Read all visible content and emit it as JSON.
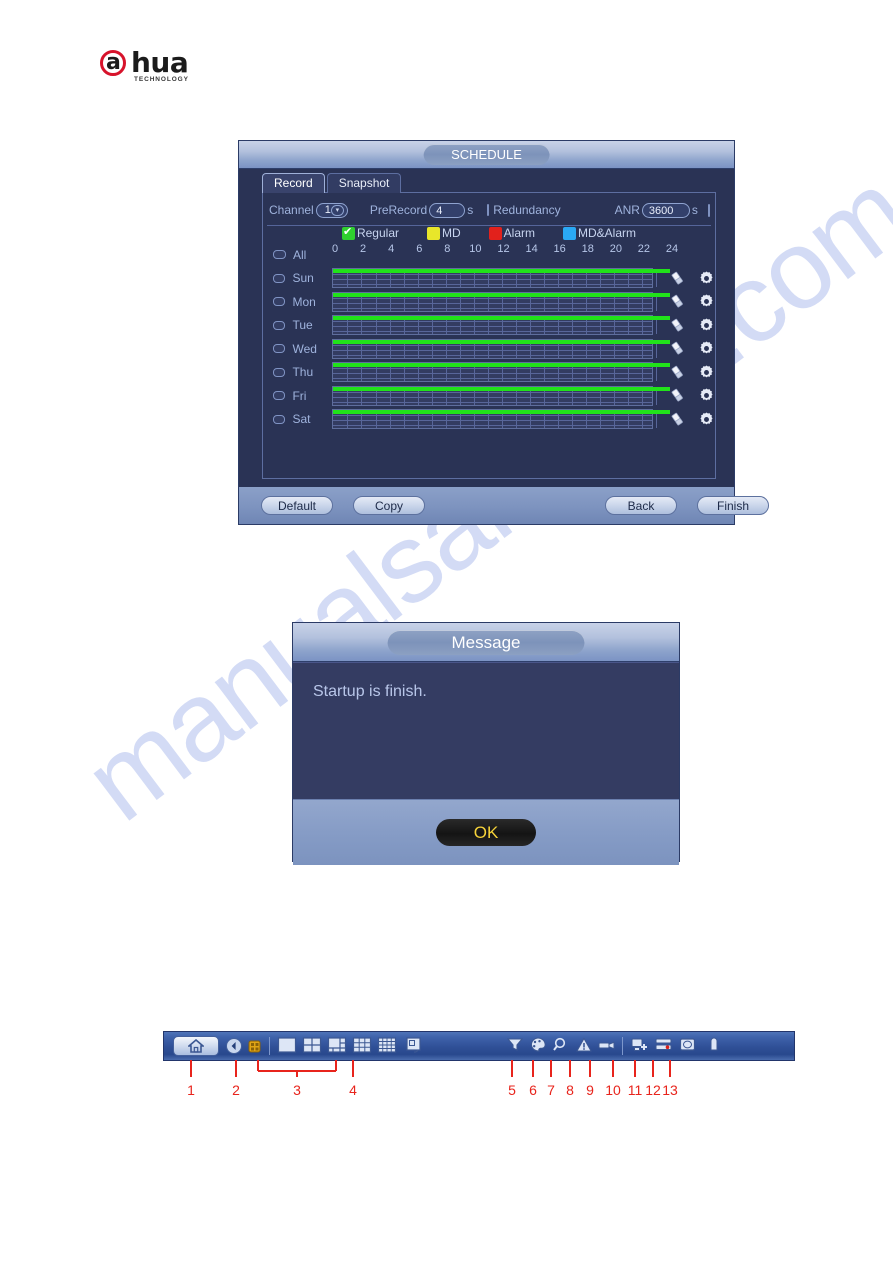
{
  "brand": {
    "name": "alhua",
    "letter": "a",
    "word": "hua",
    "tagline": "TECHNOLOGY"
  },
  "watermark": {
    "text": "manualsarchive.com"
  },
  "schedule_window": {
    "title": "SCHEDULE",
    "tabs": [
      {
        "label": "Record",
        "active": true
      },
      {
        "label": "Snapshot",
        "active": false
      }
    ],
    "options": {
      "channel_label": "Channel",
      "channel_value": "1",
      "prerecord_label": "PreRecord",
      "prerecord_value": "4",
      "prerecord_unit": "s",
      "redundancy_label": "Redundancy",
      "redundancy_checked": false,
      "anr_label": "ANR",
      "anr_value": "3600",
      "anr_unit": "s",
      "anr_checked": false
    },
    "legend": [
      {
        "label": "Regular",
        "color": "#2fcf2f",
        "checked": true
      },
      {
        "label": "MD",
        "color": "#e8e62a",
        "checked": false
      },
      {
        "label": "Alarm",
        "color": "#e2211c",
        "checked": false
      },
      {
        "label": "MD&Alarm",
        "color": "#2aa9f5",
        "checked": false
      }
    ],
    "axis_ticks": [
      "0",
      "2",
      "4",
      "6",
      "8",
      "10",
      "12",
      "14",
      "16",
      "18",
      "20",
      "22",
      "24"
    ],
    "rows": [
      {
        "label": "All",
        "checked": false,
        "has_track": false
      },
      {
        "label": "Sun",
        "checked": false,
        "has_track": true,
        "bar_start": 0,
        "bar_end": 24
      },
      {
        "label": "Mon",
        "checked": false,
        "has_track": true,
        "bar_start": 0,
        "bar_end": 24
      },
      {
        "label": "Tue",
        "checked": false,
        "has_track": true,
        "bar_start": 0,
        "bar_end": 24
      },
      {
        "label": "Wed",
        "checked": false,
        "has_track": true,
        "bar_start": 0,
        "bar_end": 24
      },
      {
        "label": "Thu",
        "checked": false,
        "has_track": true,
        "bar_start": 0,
        "bar_end": 24
      },
      {
        "label": "Fri",
        "checked": false,
        "has_track": true,
        "bar_start": 0,
        "bar_end": 24
      },
      {
        "label": "Sat",
        "checked": false,
        "has_track": true,
        "bar_start": 0,
        "bar_end": 24
      }
    ],
    "row_icons": [
      "eraser-icon",
      "gear-icon"
    ],
    "buttons": {
      "default": "Default",
      "copy": "Copy",
      "back": "Back",
      "finish": "Finish"
    }
  },
  "message_window": {
    "title": "Message",
    "text": "Startup is finish.",
    "ok_label": "OK"
  },
  "toolbar": {
    "items": [
      {
        "name": "home-button",
        "icon": "home-icon"
      },
      {
        "name": "back-button",
        "icon": "chevron-left-circle-icon"
      },
      {
        "name": "ptz-button",
        "icon": "ptz-icon"
      },
      {
        "name": "view-1-button",
        "icon": "split-1-icon"
      },
      {
        "name": "view-4-button",
        "icon": "split-4-icon"
      },
      {
        "name": "view-6-button",
        "icon": "split-6-icon"
      },
      {
        "name": "view-9-button",
        "icon": "split-9-icon"
      },
      {
        "name": "view-16-button",
        "icon": "split-16-icon"
      },
      {
        "name": "window-switch-button",
        "icon": "window-switch-icon"
      },
      {
        "name": "pan-tilt-zoom-button",
        "icon": "funnel-icon"
      },
      {
        "name": "color-setting-button",
        "icon": "palette-icon"
      },
      {
        "name": "search-button",
        "icon": "magnifier-icon"
      },
      {
        "name": "alarm-button",
        "icon": "warning-triangle-icon"
      },
      {
        "name": "channel-info-button",
        "icon": "camera-icon"
      },
      {
        "name": "remote-device-button",
        "icon": "add-device-icon"
      },
      {
        "name": "network-button",
        "icon": "network-icon"
      },
      {
        "name": "hdd-manager-button",
        "icon": "monitor-icon"
      },
      {
        "name": "usb-manager-button",
        "icon": "usb-icon"
      }
    ]
  },
  "callouts": {
    "numbers": [
      "1",
      "2",
      "3",
      "4",
      "5",
      "6",
      "7",
      "8",
      "9",
      "10",
      "11",
      "12",
      "13"
    ],
    "color": "#e8241c"
  }
}
